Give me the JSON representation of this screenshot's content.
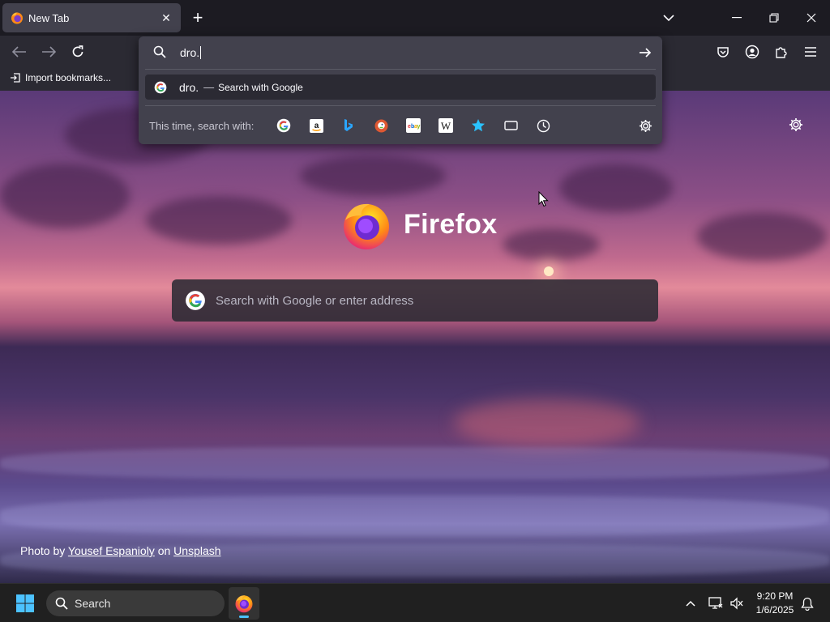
{
  "tab": {
    "title": "New Tab",
    "close_symbol": "✕"
  },
  "toolbar": {
    "new_tab_symbol": "+"
  },
  "bookmarks": {
    "import_label": "Import bookmarks..."
  },
  "urlbar": {
    "typed_text": "dro.",
    "result": {
      "text": "dro.",
      "dash": "—",
      "action": "Search with Google"
    },
    "one_off_label": "This time, search with:",
    "engines": [
      "google-icon",
      "amazon-icon",
      "bing-icon",
      "duckduckgo-icon",
      "ebay-icon",
      "wikipedia-icon",
      "bookmarks-star-icon",
      "tabs-icon",
      "history-icon"
    ]
  },
  "newtab": {
    "brand_name": "Firefox",
    "search_placeholder": "Search with Google or enter address",
    "credit_prefix": "Photo by",
    "credit_author": "Yousef Espanioly",
    "credit_on": "on",
    "credit_site": "Unsplash"
  },
  "taskbar": {
    "search_label": "Search",
    "time": "9:20 PM",
    "date": "1/6/2025"
  },
  "colors": {
    "frame": "#1c1b22",
    "toolbar": "#2b2a33",
    "popup": "#42414d",
    "taskbar": "#202020",
    "accent_blue": "#4cc2ff"
  }
}
